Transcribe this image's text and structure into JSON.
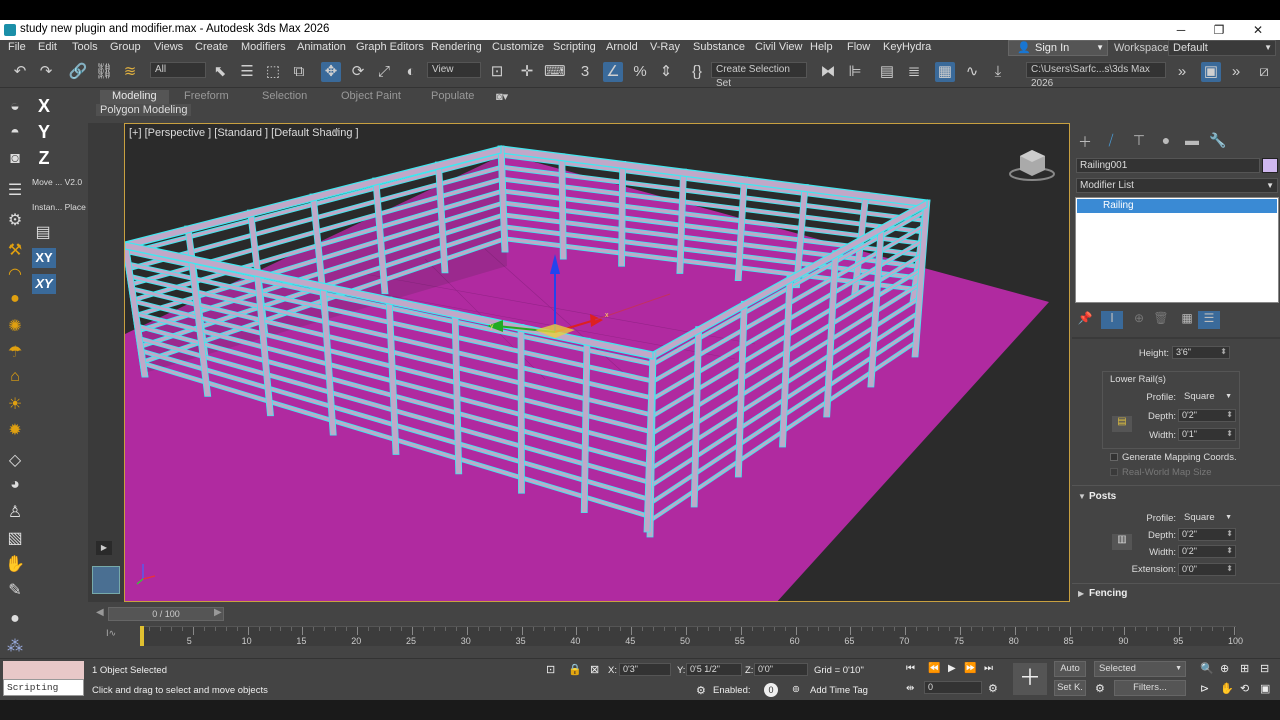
{
  "window": {
    "title": "study new plugin and modifier.max - Autodesk 3ds Max 2026"
  },
  "menu": [
    "File",
    "Edit",
    "Tools",
    "Group",
    "Views",
    "Create",
    "Modifiers",
    "Animation",
    "Graph Editors",
    "Rendering",
    "Customize",
    "Scripting",
    "Arnold",
    "V-Ray",
    "Substance",
    "Civil View",
    "Help",
    "Flow",
    "KeyHydra"
  ],
  "account": {
    "signin": "Sign In",
    "workspaces_label": "Workspaces:",
    "workspace_value": "Default"
  },
  "toolbar": {
    "selection_filter": "All",
    "ref_coord": "View",
    "named_selection": "Create Selection Set",
    "project_path": "C:\\Users\\Sarfc...s\\3ds Max 2026"
  },
  "ribbon": {
    "tabs": [
      "Modeling",
      "Freeform",
      "Selection",
      "Object Paint",
      "Populate"
    ],
    "subtab": "Polygon Modeling"
  },
  "left_panel": {
    "move_label": "Move ... V2.0",
    "instance_label": "Instan... Place",
    "axis": [
      "X",
      "Y",
      "Z",
      "XY",
      "XY"
    ]
  },
  "viewport": {
    "label": "[+] [Perspective ] [Standard ] [Default Shading ]"
  },
  "command_panel": {
    "object_name": "Railing001",
    "modifier_list": "Modifier List",
    "stack": [
      "Railing"
    ],
    "params": {
      "height_label": "Height:",
      "height": "3'6\"",
      "lower_rails": "Lower Rail(s)",
      "profile_label": "Profile:",
      "lower_profile": "Square",
      "depth_label": "Depth:",
      "lower_depth": "0'2\"",
      "width_label": "Width:",
      "lower_width": "0'1\"",
      "gen_mapping": "Generate Mapping Coords.",
      "real_world": "Real-World Map Size",
      "posts_title": "Posts",
      "posts_profile": "Square",
      "posts_depth": "0'2\"",
      "posts_width": "0'2\"",
      "extension_label": "Extension:",
      "posts_extension": "0'0\"",
      "fencing_title": "Fencing"
    }
  },
  "timeline": {
    "slider": "0 / 100",
    "ticks": [
      "5",
      "10",
      "15",
      "20",
      "25",
      "30",
      "35",
      "40",
      "45",
      "50",
      "55",
      "60",
      "65",
      "70",
      "75",
      "80",
      "85",
      "90",
      "95",
      "100"
    ]
  },
  "status": {
    "selected": "1 Object Selected",
    "prompt": "Click and drag to select and move objects",
    "x_label": "X:",
    "x": "0'3\"",
    "y_label": "Y:",
    "y": "0'5 1/2\"",
    "z_label": "Z:",
    "z": "0'0\"",
    "grid": "Grid = 0'10\"",
    "enabled": "Enabled:",
    "add_time_tag": "Add Time Tag",
    "auto": "Auto",
    "setk": "Set K.",
    "selected_dd": "Selected",
    "filters": "Filters...",
    "frame": "0",
    "script_mini": "Scripting Mini"
  },
  "colors": {
    "ground": "#b02aa0",
    "rail_outline": "#40e8f0",
    "rail_fill": "#c0a8c8",
    "selection_blue": "#3a8ad4"
  }
}
